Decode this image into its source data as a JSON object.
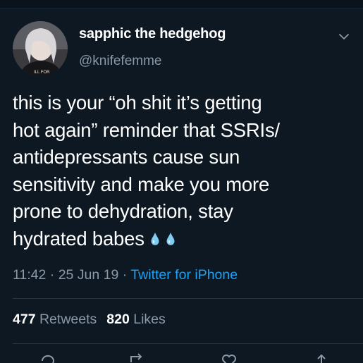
{
  "author": {
    "display_name": "sapphic the hedgehog",
    "handle": "@knifefemme",
    "avatar_shirt_text": "ILL FOR"
  },
  "tweet": {
    "lines": [
      "this is your “oh shit it’s getting",
      "hot again” reminder that SSRIs/",
      "antidepressants cause sun",
      "sensitivity and make you more",
      "prone to dehydration, stay",
      "hydrated babes"
    ],
    "emoji": [
      "droplet-icon",
      "droplet-icon"
    ]
  },
  "meta": {
    "time": "11:42",
    "separator": " · ",
    "date": "25 Jun 19",
    "source": "Twitter for iPhone"
  },
  "stats": {
    "retweets_count": "477",
    "retweets_label": "Retweets",
    "likes_count": "820",
    "likes_label": "Likes"
  },
  "colors": {
    "background": "#0e1823",
    "secondary_text": "#8a99a8",
    "link": "#1da1f2",
    "divider": "#263445"
  }
}
